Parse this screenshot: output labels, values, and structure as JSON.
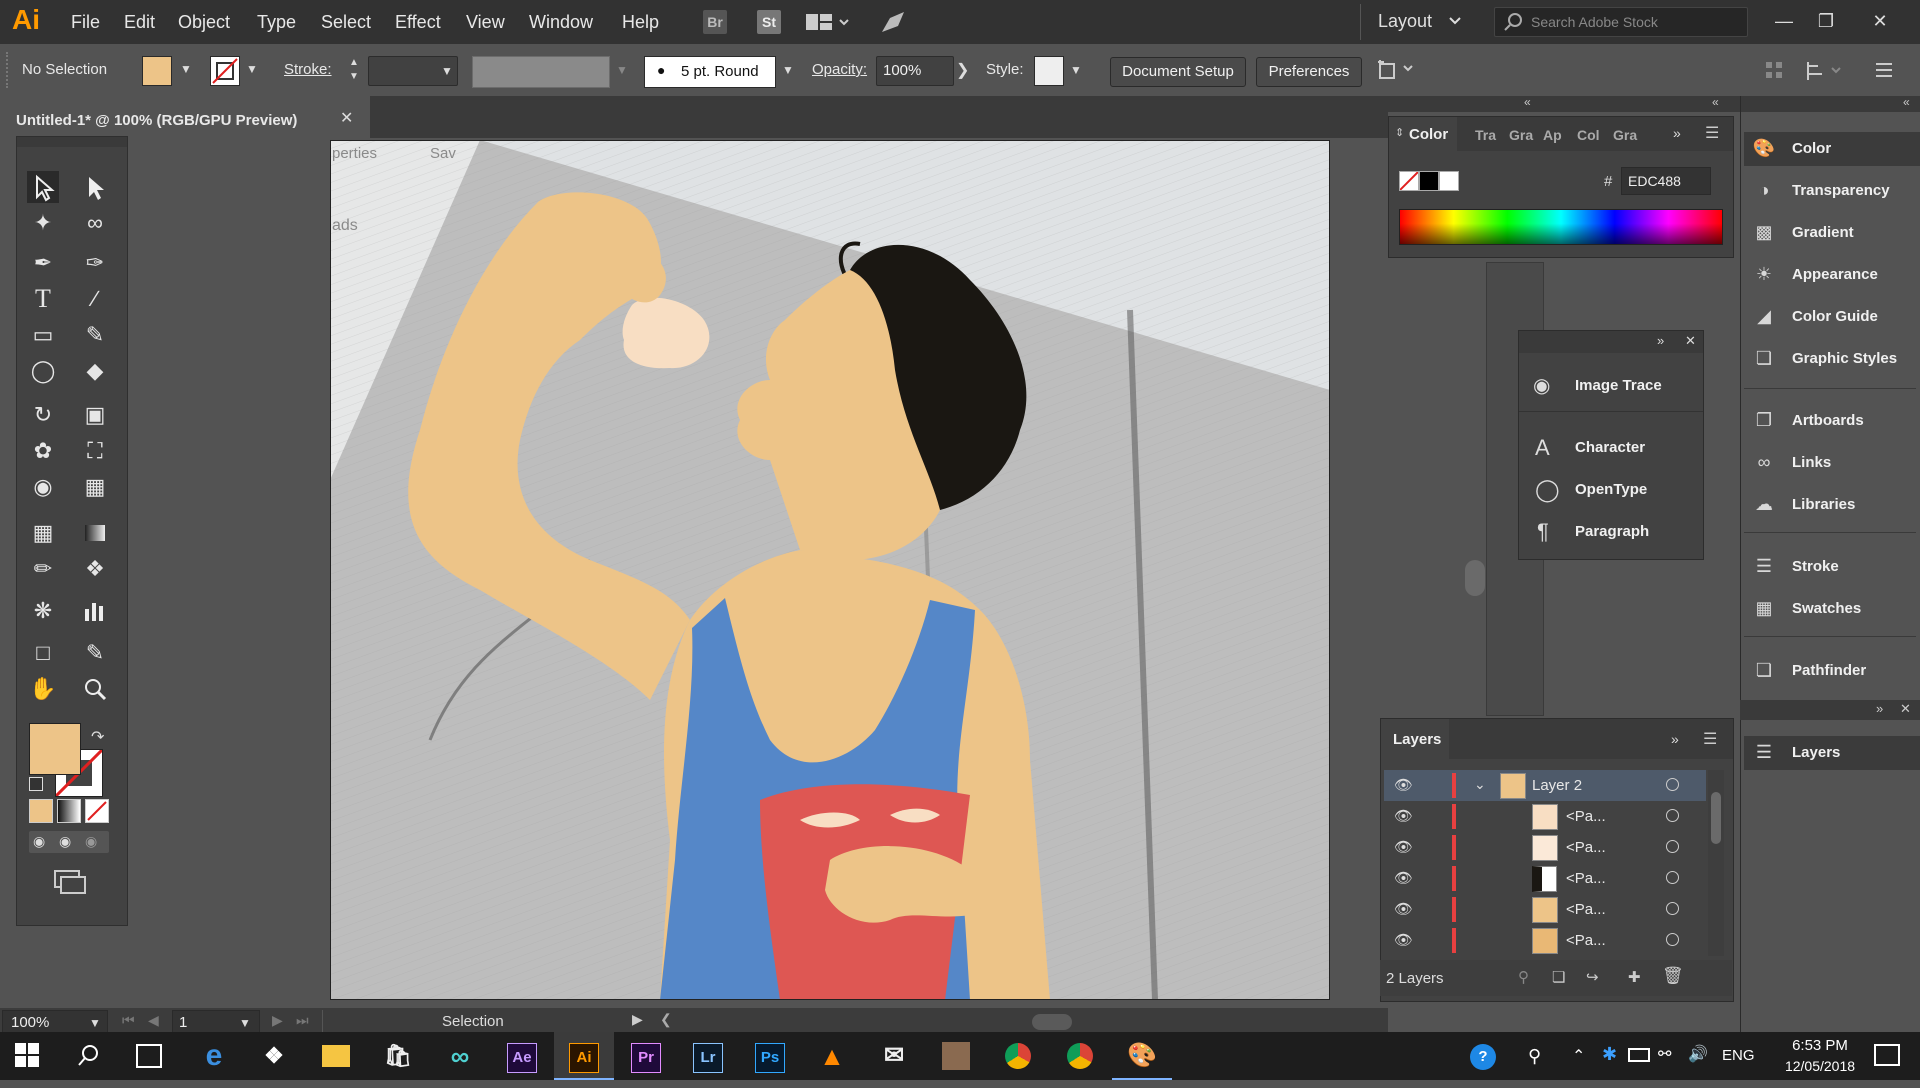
{
  "menubar": {
    "logo": "Ai",
    "items": [
      "File",
      "Edit",
      "Object",
      "Type",
      "Select",
      "Effect",
      "View",
      "Window",
      "Help"
    ],
    "bridge": "Br",
    "stock": "St",
    "workspace": "Layout",
    "search_placeholder": "Search Adobe Stock"
  },
  "controlbar": {
    "selection": "No Selection",
    "stroke_label": "Stroke:",
    "brush": "5 pt. Round",
    "opacity_label": "Opacity:",
    "opacity_value": "100%",
    "style_label": "Style:",
    "document_setup": "Document Setup",
    "preferences": "Preferences"
  },
  "document": {
    "tab_title": "Untitled-1* @ 100% (RGB/GPU Preview)",
    "ghost_properties": "perties",
    "ghost_save": "Sav",
    "ghost_ads": "ads"
  },
  "statusbar": {
    "zoom": "100%",
    "artboard": "1",
    "tool": "Selection"
  },
  "color_panel": {
    "tabs": [
      "Color",
      "Tra",
      "Gra",
      "Ap",
      "Col",
      "Gra"
    ],
    "hash": "#",
    "hex": "EDC488",
    "fill_color": "#EDC488"
  },
  "floating_panel": {
    "items": [
      "Image Trace",
      "Character",
      "OpenType",
      "Paragraph"
    ]
  },
  "dock": {
    "items": [
      "Color",
      "Transparency",
      "Gradient",
      "Appearance",
      "Color Guide",
      "Graphic Styles",
      "Artboards",
      "Links",
      "Libraries",
      "Stroke",
      "Swatches",
      "Pathfinder",
      "Layers"
    ]
  },
  "layers_panel": {
    "title": "Layers",
    "parent": "Layer 2",
    "children": [
      "<Pa...",
      "<Pa...",
      "<Pa...",
      "<Pa...",
      "<Pa..."
    ],
    "count": "2 Layers"
  },
  "taskbar": {
    "apps": [
      "Ae",
      "Ai",
      "Pr",
      "Lr",
      "Ps"
    ],
    "lang": "ENG",
    "time": "6:53 PM",
    "date": "12/05/2018"
  },
  "colors": {
    "skin": "#EDC488",
    "shirt": "#5587C8",
    "bag": "#DE5753",
    "hair": "#1A1712",
    "chip": "#F8DEC3"
  }
}
